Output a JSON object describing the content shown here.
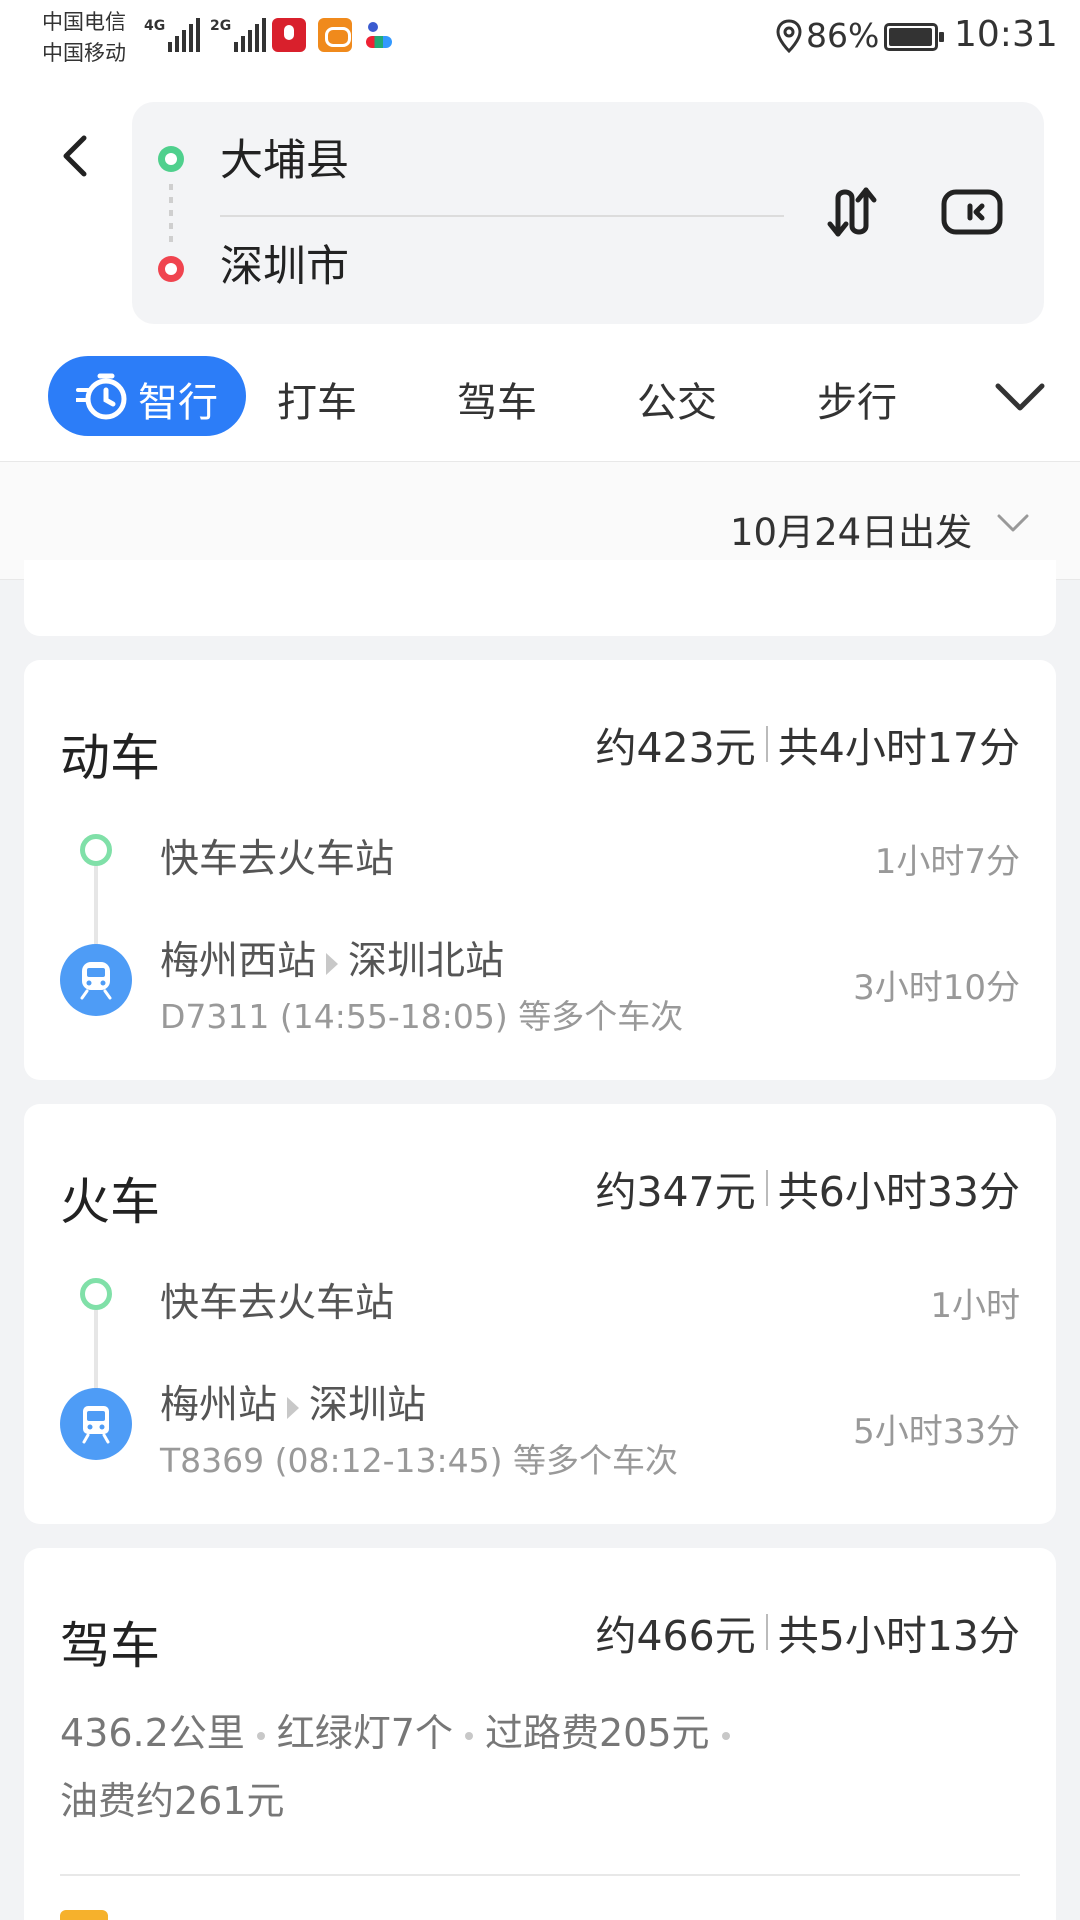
{
  "status": {
    "carrier1": "中国电信",
    "carrier2": "中国移动",
    "sim1_network": "4G",
    "sim2_network": "2G",
    "battery": "86%",
    "time": "10:31"
  },
  "route": {
    "from": "大埔县",
    "to": "深圳市"
  },
  "modes": {
    "active": "智行",
    "items": [
      "打车",
      "驾车",
      "公交",
      "步行"
    ]
  },
  "date": {
    "label": "10月24日出发"
  },
  "cards": {
    "emu": {
      "title": "动车",
      "price": "约423元",
      "total": "共4小时17分",
      "leg1": {
        "text": "快车去火车站",
        "duration": "1小时7分"
      },
      "leg2": {
        "from": "梅州西站",
        "to": "深圳北站",
        "detail": "D7311 (14:55-18:05) 等多个车次",
        "duration": "3小时10分"
      }
    },
    "train": {
      "title": "火车",
      "price": "约347元",
      "total": "共6小时33分",
      "leg1": {
        "text": "快车去火车站",
        "duration": "1小时"
      },
      "leg2": {
        "from": "梅州站",
        "to": "深圳站",
        "detail": "T8369 (08:12-13:45) 等多个车次",
        "duration": "5小时33分"
      }
    },
    "drive": {
      "title": "驾车",
      "price": "约466元",
      "total": "共5小时13分",
      "distance": "436.2公里",
      "lights": "红绿灯7个",
      "toll": "过路费205元",
      "fuel": "油费约261元"
    }
  },
  "colors": {
    "accent": "#2c7df8",
    "start_dot": "#4fd08d",
    "end_dot": "#f0444f",
    "train_icon_bg": "#4e9cf6"
  }
}
